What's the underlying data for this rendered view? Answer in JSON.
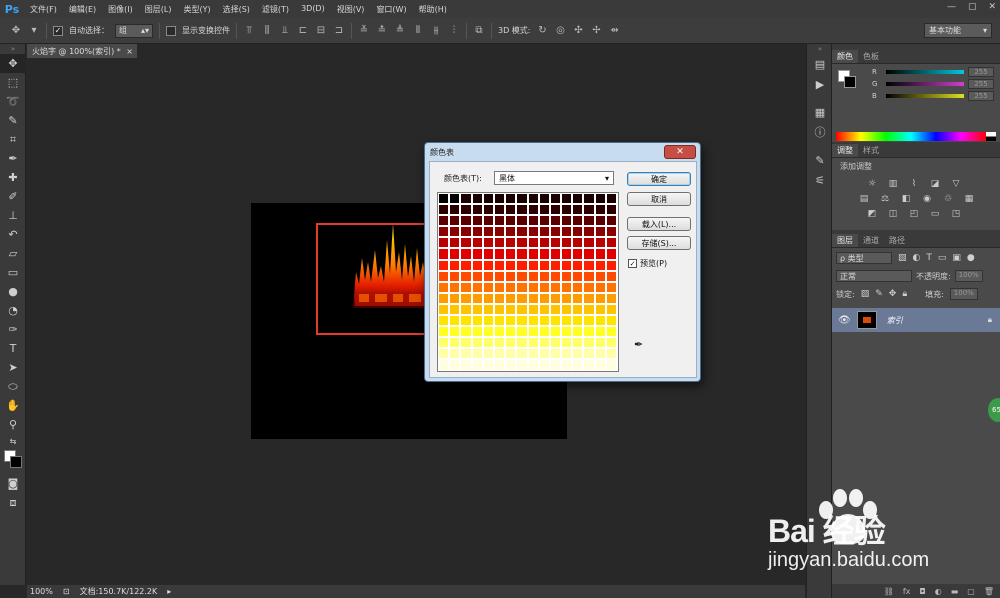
{
  "app": {
    "logo": "Ps"
  },
  "menu": [
    "文件(F)",
    "编辑(E)",
    "图像(I)",
    "图层(L)",
    "类型(Y)",
    "选择(S)",
    "滤镜(T)",
    "3D(D)",
    "视图(V)",
    "窗口(W)",
    "帮助(H)"
  ],
  "options": {
    "auto_select_label": "自动选择：",
    "auto_select_value": "组",
    "show_transform_label": "显示变换控件",
    "mode_3d_label": "3D 模式:",
    "workspace": "基本功能"
  },
  "document": {
    "tab_title": "火焰字 @ 100%(索引) *",
    "tab_close": "×"
  },
  "status": {
    "zoom": "100%",
    "doc_info": "文档:150.7K/122.2K"
  },
  "panels": {
    "color": {
      "tabs": [
        "颜色",
        "色板"
      ],
      "channels": [
        {
          "label": "R",
          "value": "255",
          "color": "#00c8e0"
        },
        {
          "label": "G",
          "value": "255",
          "color": "#d040d0"
        },
        {
          "label": "B",
          "value": "255",
          "color": "#e0e020"
        }
      ]
    },
    "adjustments": {
      "tabs": [
        "调整",
        "样式"
      ],
      "title": "添加调整"
    },
    "layers": {
      "tabs": [
        "图层",
        "通道",
        "路径"
      ],
      "filter_label": "ρ 类型",
      "blend_mode": "正常",
      "opacity_label": "不透明度:",
      "opacity_value": "100%",
      "lock_label": "锁定:",
      "fill_label": "填充:",
      "fill_value": "100%",
      "layer_name": "索引"
    }
  },
  "dialog": {
    "title": "颜色表",
    "close": "✕",
    "table_label": "颜色表(T):",
    "table_value": "黑体",
    "buttons": {
      "ok": "确定",
      "cancel": "取消",
      "load": "载入(L)...",
      "save": "存储(S)..."
    },
    "preview_label": "预览(P)",
    "preview_checked": "✓",
    "swatch_stops": [
      "#000000",
      "#2a0000",
      "#5a0000",
      "#8a0000",
      "#b80000",
      "#e00000",
      "#ff1e00",
      "#ff4a00",
      "#ff7400",
      "#ff9c00",
      "#ffc400",
      "#ffe400",
      "#ffff20",
      "#ffff66",
      "#ffffa8",
      "#ffffe0"
    ]
  },
  "watermark": {
    "brand": "Bai  经验",
    "url": "jingyan.baidu.com"
  },
  "badge": "65"
}
